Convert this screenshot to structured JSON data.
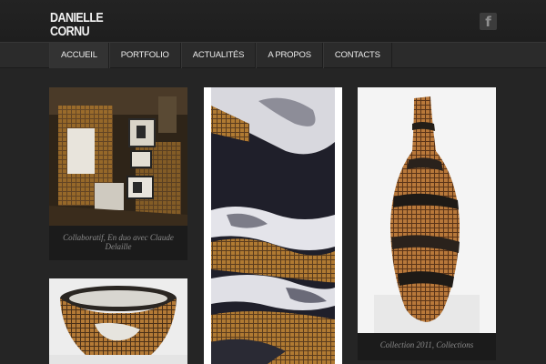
{
  "site": {
    "title_line1": "DANIELLE",
    "title_line2": "CORNU"
  },
  "social": {
    "facebook_icon": "facebook-icon",
    "facebook_glyph": "f"
  },
  "nav": {
    "items": [
      {
        "label": "ACCUEIL"
      },
      {
        "label": "PORTFOLIO"
      },
      {
        "label": "ACTUALITÉS"
      },
      {
        "label": "A PROPOS"
      },
      {
        "label": "CONTACTS"
      }
    ]
  },
  "gallery": {
    "items": [
      {
        "caption": "Collaboratif, En duo avec Claude Delaille"
      },
      {
        "caption": ""
      },
      {
        "caption": "Collection 2011, Collections"
      },
      {
        "caption": ""
      }
    ]
  },
  "colors": {
    "background": "#252525",
    "header": "#1f1f1f",
    "caption_bg": "#1b1b1b",
    "caption_text": "#8b8b8b"
  }
}
